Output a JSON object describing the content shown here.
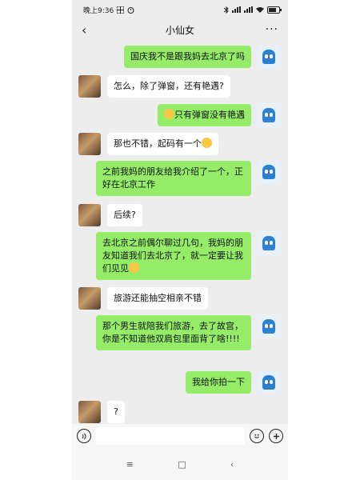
{
  "status": {
    "time": "晚上9:36"
  },
  "header": {
    "back_icon": "‹",
    "title": "小仙女",
    "more_icon": "···"
  },
  "messages": [
    {
      "side": "right",
      "text": "国庆我不是跟我妈去北京了吗"
    },
    {
      "side": "left",
      "text": "怎么，除了弹窗，还有艳遇?"
    },
    {
      "side": "right",
      "emoji": "grinning-sweat-emoji",
      "text": "只有弹窗没有艳遇"
    },
    {
      "side": "left",
      "text": "那也不错，起码有一个",
      "emoji_after": "thinking-emoji"
    },
    {
      "side": "right",
      "text": "之前我妈的朋友给我介绍了一个，正好在北京工作"
    },
    {
      "side": "left",
      "text": "后续?"
    },
    {
      "side": "right",
      "text": "去北京之前偶尔聊过几句，我妈的朋友知道我们去北京了，就一定要让我们见见",
      "emoji_after": "grimace-emoji"
    },
    {
      "side": "left",
      "text": "旅游还能抽空相亲不错"
    },
    {
      "side": "right",
      "text": "那个男生就陪我们旅游，去了故宫，你是不知道他双肩包里面背了啥!!!!"
    },
    {
      "side": "right",
      "text": "我给你拍一下"
    },
    {
      "side": "left",
      "text": "?"
    }
  ],
  "input": {
    "voice_icon": "voice-icon",
    "emoji_icon": "emoji-icon",
    "plus_icon": "plus-icon"
  },
  "nav": {
    "menu_icon": "≡",
    "home_icon": "□",
    "back_icon": "‹"
  }
}
